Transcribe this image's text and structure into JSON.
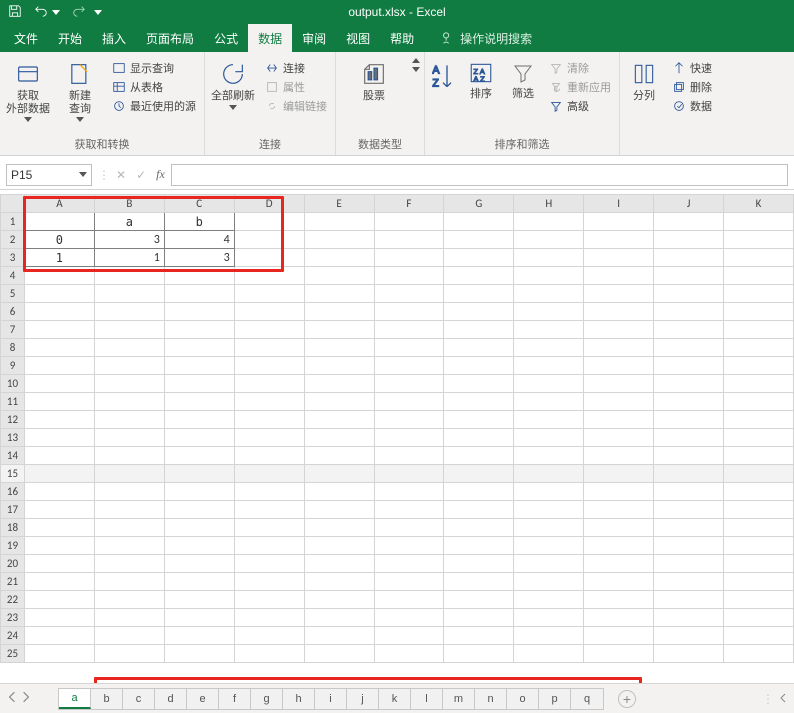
{
  "title": "output.xlsx - Excel",
  "quick_access": {
    "save": "save-icon",
    "undo": "undo-icon",
    "redo": "redo-icon"
  },
  "tabs": {
    "file": "文件",
    "home": "开始",
    "insert": "插入",
    "page_layout": "页面布局",
    "formulas": "公式",
    "data": "数据",
    "review": "审阅",
    "view": "视图",
    "help": "帮助",
    "tell_me": "操作说明搜索",
    "active": "data"
  },
  "ribbon": {
    "g1": {
      "get_data": "获取\n外部数据",
      "new_query": "新建\n查询",
      "show_queries": "显示查询",
      "from_table": "从表格",
      "recent_sources": "最近使用的源",
      "label": "获取和转换"
    },
    "g2": {
      "refresh_all": "全部刷新",
      "connections": "连接",
      "properties": "属性",
      "edit_links": "编辑链接",
      "label": "连接"
    },
    "g3": {
      "stocks": "股票",
      "label": "数据类型"
    },
    "g4": {
      "sort": "排序",
      "filter": "筛选",
      "clear": "清除",
      "reapply": "重新应用",
      "advanced": "高级",
      "label": "排序和筛选"
    },
    "g5": {
      "text_to_columns": "分列",
      "flash_fill": "快速",
      "remove_dup": "删除",
      "data_valid": "数据"
    }
  },
  "name_box": "P15",
  "formula": "",
  "columns": [
    "A",
    "B",
    "C",
    "D",
    "E",
    "F",
    "G",
    "H",
    "I",
    "J",
    "K"
  ],
  "row_count": 25,
  "active_cell": {
    "row": 15,
    "col_label": "P"
  },
  "table": {
    "headers": [
      "",
      "a",
      "b"
    ],
    "index": [
      "0",
      "1"
    ],
    "data": [
      [
        3,
        4
      ],
      [
        1,
        3
      ]
    ]
  },
  "sheet_tabs": [
    "a",
    "b",
    "c",
    "d",
    "e",
    "f",
    "g",
    "h",
    "i",
    "j",
    "k",
    "l",
    "m",
    "n",
    "o",
    "p",
    "q"
  ],
  "active_sheet": "a"
}
